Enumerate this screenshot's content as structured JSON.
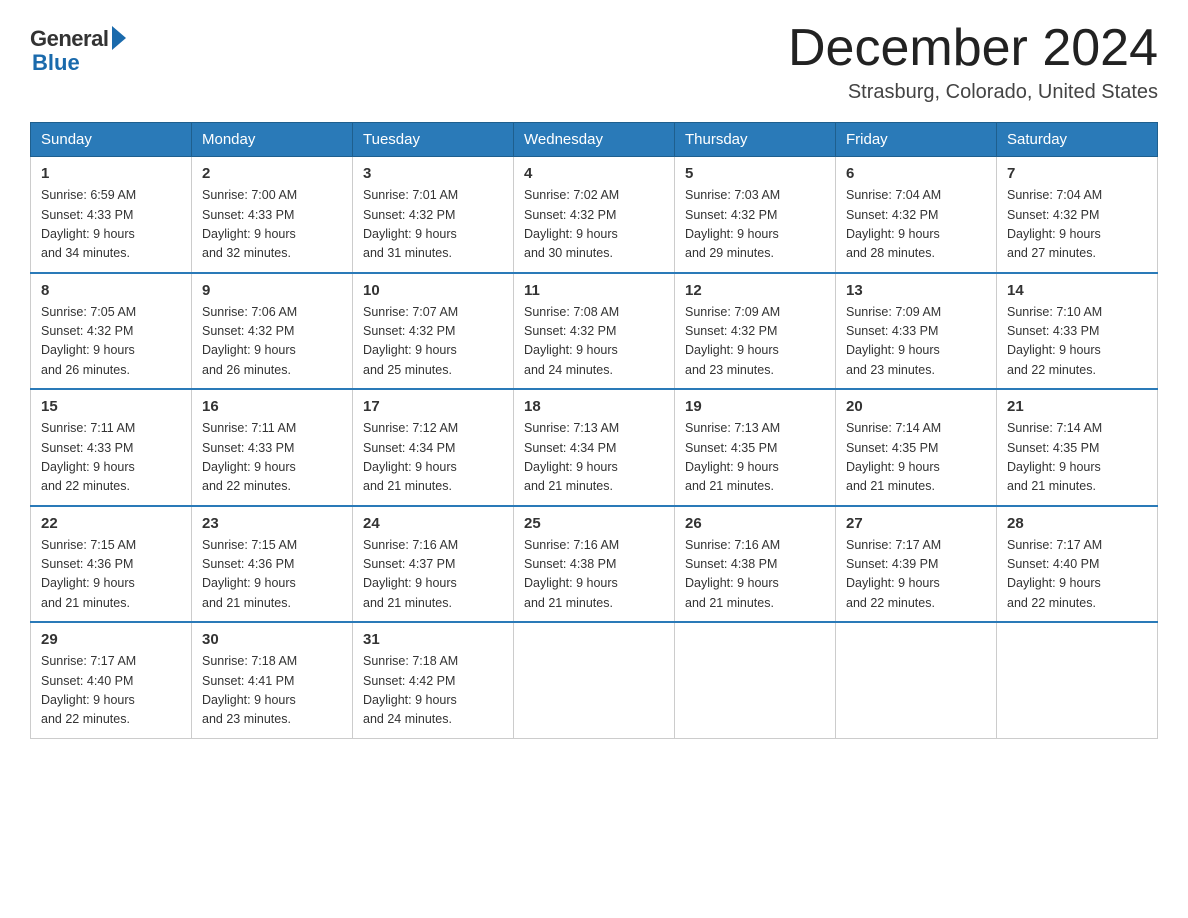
{
  "header": {
    "logo_general": "General",
    "logo_blue": "Blue",
    "title": "December 2024",
    "location": "Strasburg, Colorado, United States"
  },
  "days_of_week": [
    "Sunday",
    "Monday",
    "Tuesday",
    "Wednesday",
    "Thursday",
    "Friday",
    "Saturday"
  ],
  "weeks": [
    [
      {
        "day": "1",
        "sunrise": "6:59 AM",
        "sunset": "4:33 PM",
        "daylight": "9 hours and 34 minutes."
      },
      {
        "day": "2",
        "sunrise": "7:00 AM",
        "sunset": "4:33 PM",
        "daylight": "9 hours and 32 minutes."
      },
      {
        "day": "3",
        "sunrise": "7:01 AM",
        "sunset": "4:32 PM",
        "daylight": "9 hours and 31 minutes."
      },
      {
        "day": "4",
        "sunrise": "7:02 AM",
        "sunset": "4:32 PM",
        "daylight": "9 hours and 30 minutes."
      },
      {
        "day": "5",
        "sunrise": "7:03 AM",
        "sunset": "4:32 PM",
        "daylight": "9 hours and 29 minutes."
      },
      {
        "day": "6",
        "sunrise": "7:04 AM",
        "sunset": "4:32 PM",
        "daylight": "9 hours and 28 minutes."
      },
      {
        "day": "7",
        "sunrise": "7:04 AM",
        "sunset": "4:32 PM",
        "daylight": "9 hours and 27 minutes."
      }
    ],
    [
      {
        "day": "8",
        "sunrise": "7:05 AM",
        "sunset": "4:32 PM",
        "daylight": "9 hours and 26 minutes."
      },
      {
        "day": "9",
        "sunrise": "7:06 AM",
        "sunset": "4:32 PM",
        "daylight": "9 hours and 26 minutes."
      },
      {
        "day": "10",
        "sunrise": "7:07 AM",
        "sunset": "4:32 PM",
        "daylight": "9 hours and 25 minutes."
      },
      {
        "day": "11",
        "sunrise": "7:08 AM",
        "sunset": "4:32 PM",
        "daylight": "9 hours and 24 minutes."
      },
      {
        "day": "12",
        "sunrise": "7:09 AM",
        "sunset": "4:32 PM",
        "daylight": "9 hours and 23 minutes."
      },
      {
        "day": "13",
        "sunrise": "7:09 AM",
        "sunset": "4:33 PM",
        "daylight": "9 hours and 23 minutes."
      },
      {
        "day": "14",
        "sunrise": "7:10 AM",
        "sunset": "4:33 PM",
        "daylight": "9 hours and 22 minutes."
      }
    ],
    [
      {
        "day": "15",
        "sunrise": "7:11 AM",
        "sunset": "4:33 PM",
        "daylight": "9 hours and 22 minutes."
      },
      {
        "day": "16",
        "sunrise": "7:11 AM",
        "sunset": "4:33 PM",
        "daylight": "9 hours and 22 minutes."
      },
      {
        "day": "17",
        "sunrise": "7:12 AM",
        "sunset": "4:34 PM",
        "daylight": "9 hours and 21 minutes."
      },
      {
        "day": "18",
        "sunrise": "7:13 AM",
        "sunset": "4:34 PM",
        "daylight": "9 hours and 21 minutes."
      },
      {
        "day": "19",
        "sunrise": "7:13 AM",
        "sunset": "4:35 PM",
        "daylight": "9 hours and 21 minutes."
      },
      {
        "day": "20",
        "sunrise": "7:14 AM",
        "sunset": "4:35 PM",
        "daylight": "9 hours and 21 minutes."
      },
      {
        "day": "21",
        "sunrise": "7:14 AM",
        "sunset": "4:35 PM",
        "daylight": "9 hours and 21 minutes."
      }
    ],
    [
      {
        "day": "22",
        "sunrise": "7:15 AM",
        "sunset": "4:36 PM",
        "daylight": "9 hours and 21 minutes."
      },
      {
        "day": "23",
        "sunrise": "7:15 AM",
        "sunset": "4:36 PM",
        "daylight": "9 hours and 21 minutes."
      },
      {
        "day": "24",
        "sunrise": "7:16 AM",
        "sunset": "4:37 PM",
        "daylight": "9 hours and 21 minutes."
      },
      {
        "day": "25",
        "sunrise": "7:16 AM",
        "sunset": "4:38 PM",
        "daylight": "9 hours and 21 minutes."
      },
      {
        "day": "26",
        "sunrise": "7:16 AM",
        "sunset": "4:38 PM",
        "daylight": "9 hours and 21 minutes."
      },
      {
        "day": "27",
        "sunrise": "7:17 AM",
        "sunset": "4:39 PM",
        "daylight": "9 hours and 22 minutes."
      },
      {
        "day": "28",
        "sunrise": "7:17 AM",
        "sunset": "4:40 PM",
        "daylight": "9 hours and 22 minutes."
      }
    ],
    [
      {
        "day": "29",
        "sunrise": "7:17 AM",
        "sunset": "4:40 PM",
        "daylight": "9 hours and 22 minutes."
      },
      {
        "day": "30",
        "sunrise": "7:18 AM",
        "sunset": "4:41 PM",
        "daylight": "9 hours and 23 minutes."
      },
      {
        "day": "31",
        "sunrise": "7:18 AM",
        "sunset": "4:42 PM",
        "daylight": "9 hours and 24 minutes."
      },
      null,
      null,
      null,
      null
    ]
  ]
}
